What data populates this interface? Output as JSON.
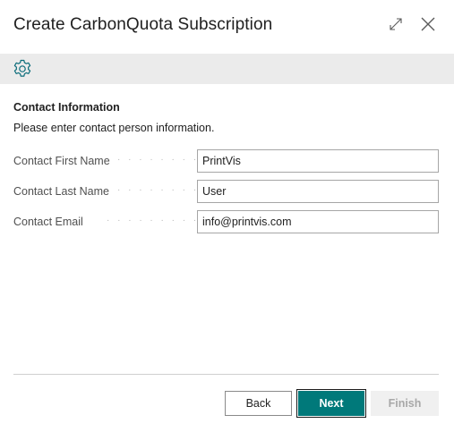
{
  "dialog": {
    "title": "Create CarbonQuota Subscription",
    "expand_icon": "expand-icon",
    "close_icon": "close-icon"
  },
  "toolbar": {
    "settings_icon": "gear-icon",
    "accent_color": "#0b6c7a",
    "background": "#ebebeb"
  },
  "section": {
    "title": "Contact Information",
    "description": "Please enter contact person information."
  },
  "fields": [
    {
      "label": "Contact First Name",
      "value": "PrintVis"
    },
    {
      "label": "Contact Last Name",
      "value": "User"
    },
    {
      "label": "Contact Email",
      "value": "info@printvis.com"
    }
  ],
  "footer": {
    "back_label": "Back",
    "next_label": "Next",
    "finish_label": "Finish",
    "primary_color": "#00797a",
    "disabled_color": "#a8a8a8"
  }
}
